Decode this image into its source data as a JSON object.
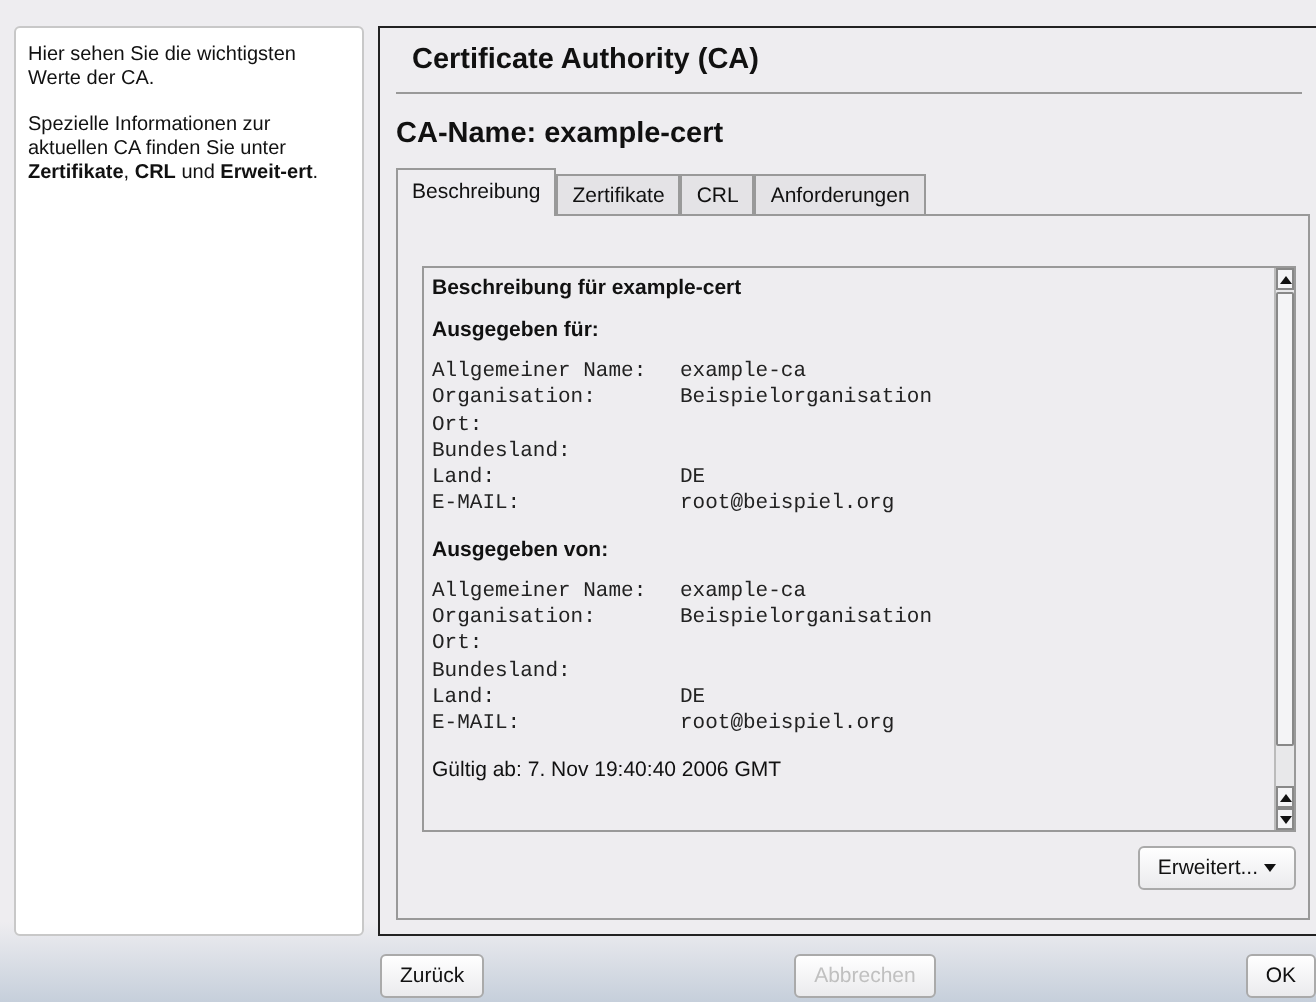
{
  "help": {
    "paragraphs": [
      "Hier sehen Sie die wichtigsten Werte der CA.",
      "Spezielle Informationen zur aktuellen CA finden Sie unter **Zertifikate**, **CRL** und **Erweit-ert**."
    ]
  },
  "title": "Certificate Authority (CA)",
  "ca_name": "CA-Name: example-cert",
  "tabs": [
    {
      "label": "Beschreibung",
      "selected": true
    },
    {
      "label": "Zertifikate",
      "selected": false
    },
    {
      "label": "CRL",
      "selected": false
    },
    {
      "label": "Anforderungen",
      "selected": false
    }
  ],
  "description": {
    "heading": "Beschreibung für example-cert",
    "sections": [
      {
        "title": "Ausgegeben für:",
        "fields": [
          {
            "label": "Allgemeiner Name:",
            "value": "example-ca"
          },
          {
            "label": "Organisation:",
            "value": "Beispielorganisation"
          },
          {
            "label": "Ort:"
          },
          {
            "label": "Bundesland:"
          },
          {
            "label": "Land:",
            "value": "DE"
          },
          {
            "label": "E-MAIL:",
            "value": "root@beispiel.org"
          }
        ]
      },
      {
        "title": "Ausgegeben von:",
        "fields": [
          {
            "label": "Allgemeiner Name:",
            "value": "example-ca"
          },
          {
            "label": "Organisation:",
            "value": "Beispielorganisation"
          },
          {
            "label": "Ort:"
          },
          {
            "label": "Bundesland:"
          },
          {
            "label": "Land:",
            "value": "DE"
          },
          {
            "label": "E-MAIL:",
            "value": "root@beispiel.org"
          }
        ]
      }
    ],
    "footer": "Gültig ab: 7. Nov 19:40:40 2006 GMT"
  },
  "advanced_button": {
    "label": "Erweitert..."
  },
  "buttons": [
    {
      "label": "Zurück",
      "disabled": false
    },
    {
      "label": "Abbrechen",
      "disabled": true
    },
    {
      "label": "OK",
      "disabled": false
    }
  ]
}
